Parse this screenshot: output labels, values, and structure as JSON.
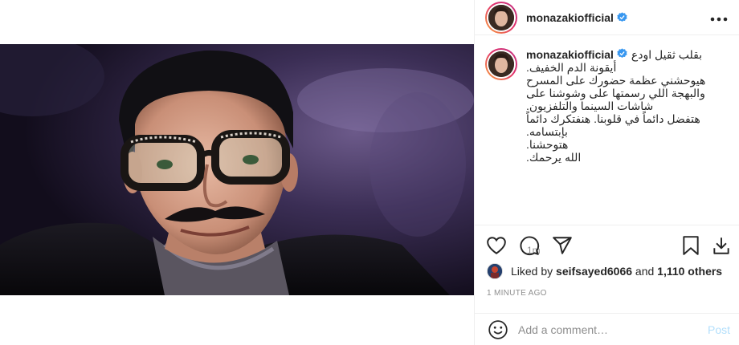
{
  "post": {
    "username": "monazakiofficial",
    "verified": true,
    "more_icon": "more-horizontal-icon"
  },
  "caption": {
    "username": "monazakiofficial",
    "lines": [
      "بقلب ثقيل اودع",
      "أيقونة الدم الخفيف.",
      "هيوحشني عظمة حضورك على المسرح",
      "والبهجة اللي رسمتها على وشوشنا على",
      "شاشات السينما والتلفزيون.",
      "هتفضل دائماً في قلوبنا. هنفتكرك دائماً",
      "بإبتسامه.",
      "هتوحشنا.",
      "الله يرحمك."
    ],
    "time": "1m"
  },
  "actions": {
    "like_icon": "heart-icon",
    "comment_icon": "comment-icon",
    "share_icon": "send-icon",
    "save_icon": "bookmark-icon",
    "download_icon": "download-icon"
  },
  "likes": {
    "prefix": "Liked by",
    "user": "seifsayed6066",
    "and": "and",
    "others": "1,110 others"
  },
  "time_ago": "1 MINUTE AGO",
  "comment_box": {
    "placeholder": "Add a comment…",
    "post_label": "Post",
    "emoji_icon": "smiley-icon"
  },
  "colors": {
    "verified_blue": "#3897f0",
    "post_disabled": "#b2dffc",
    "muted": "#8e8e8e"
  }
}
